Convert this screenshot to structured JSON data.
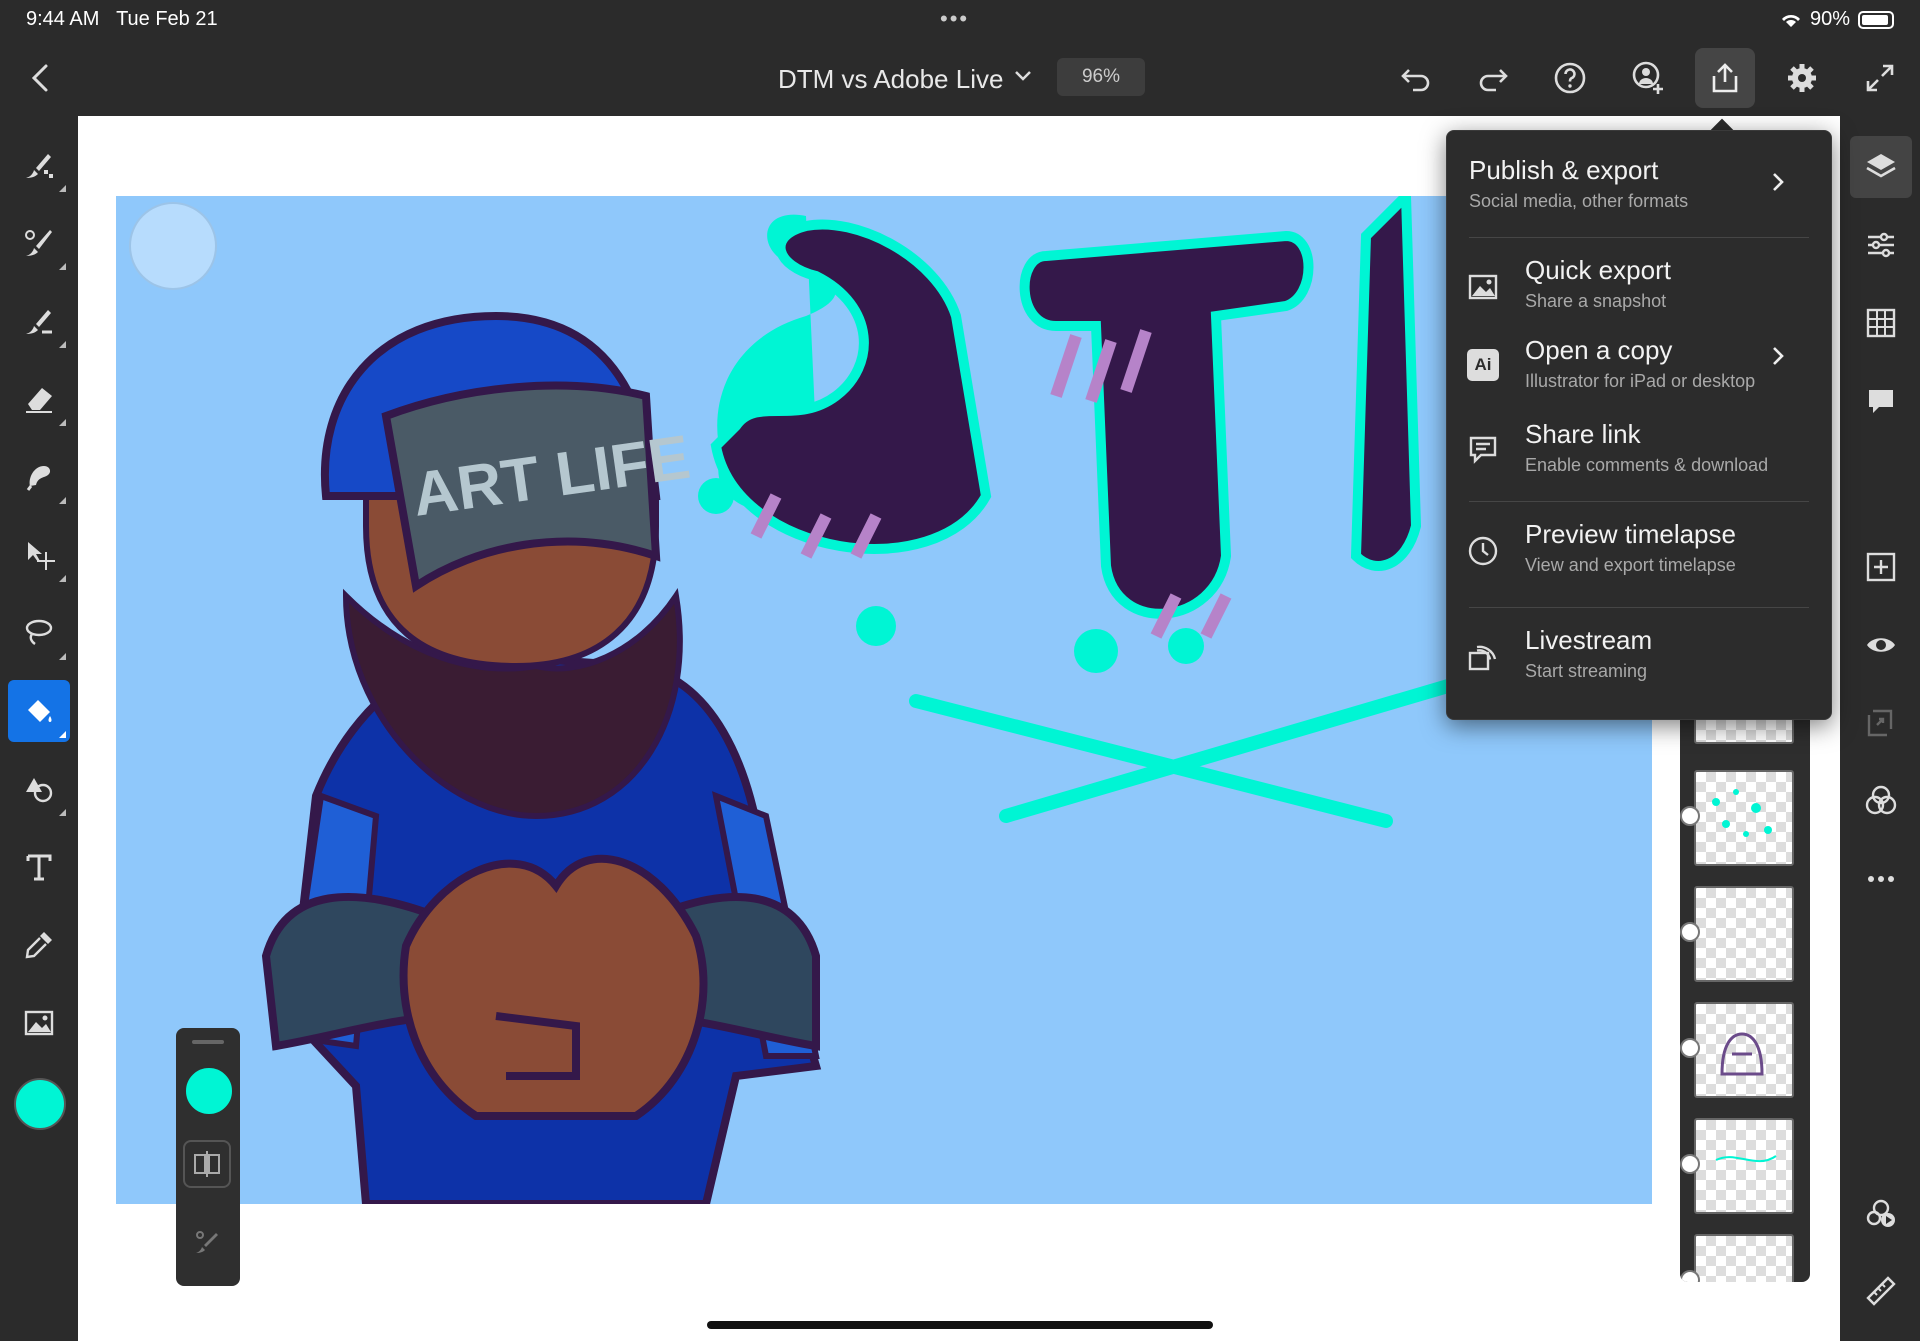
{
  "status": {
    "time": "9:44 AM",
    "date": "Tue Feb 21",
    "battery": "90%"
  },
  "header": {
    "title": "DTM vs Adobe Live",
    "zoom": "96%"
  },
  "export_menu": {
    "items": [
      {
        "title": "Publish & export",
        "subtitle": "Social media, other formats",
        "icon": "chevron-right-icon"
      },
      {
        "title": "Quick export",
        "subtitle": "Share a snapshot",
        "icon": "image-icon"
      },
      {
        "title": "Open a copy",
        "subtitle": "Illustrator for iPad or desktop",
        "icon": "illustrator-icon",
        "badge": "Ai"
      },
      {
        "title": "Share link",
        "subtitle": "Enable comments & download",
        "icon": "comment-icon"
      },
      {
        "title": "Preview timelapse",
        "subtitle": "View and export timelapse",
        "icon": "clock-icon"
      },
      {
        "title": "Livestream",
        "subtitle": "Start streaming",
        "icon": "livestream-icon"
      }
    ]
  },
  "artwork": {
    "cap_text": "ART LIFE",
    "logo_text": "DTM"
  },
  "colors": {
    "accent": "#1473e6",
    "current_color": "#00f5d4",
    "artboard": "#8fc8fb",
    "navy": "#34184a"
  }
}
